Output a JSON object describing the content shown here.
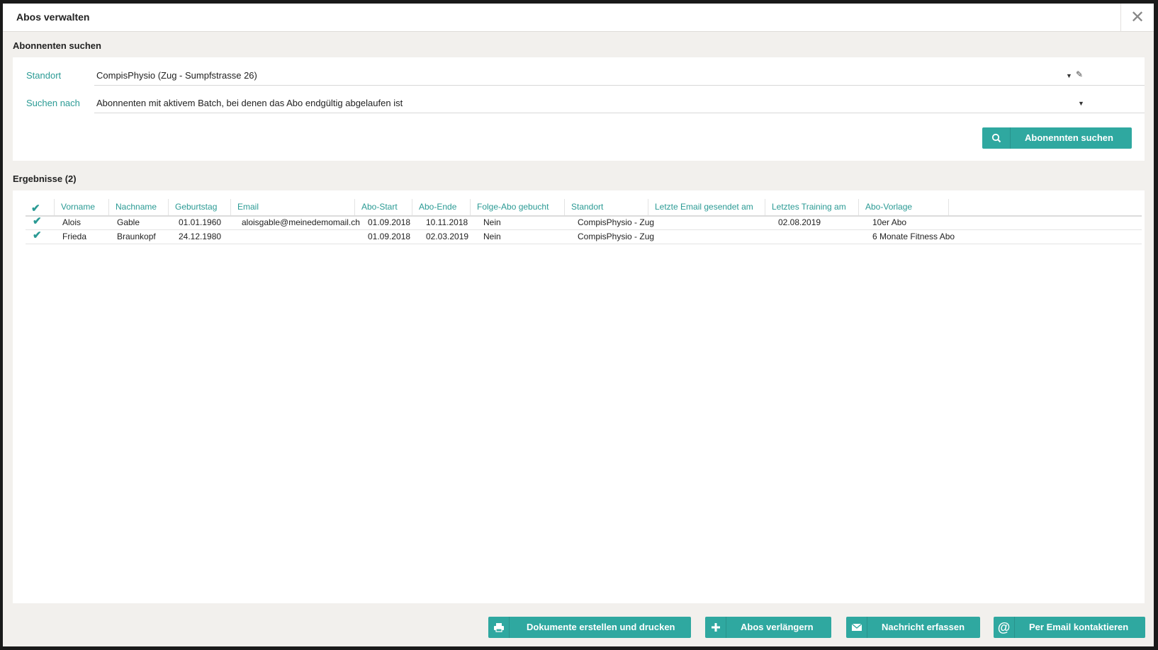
{
  "dialog": {
    "title": "Abos verwalten",
    "close_icon": "close-icon"
  },
  "search": {
    "section_title": "Abonnenten suchen",
    "standort_label": "Standort",
    "standort_value": "CompisPhysio (Zug - Sumpfstrasse 26)",
    "suchen_label": "Suchen nach",
    "suchen_value": "Abonnenten mit aktivem Batch, bei denen das Abo endgültig abgelaufen ist",
    "button_label": "Abonennten suchen"
  },
  "results": {
    "title": "Ergebnisse (2)",
    "columns": [
      "Vorname",
      "Nachname",
      "Geburtstag",
      "Email",
      "Abo-Start",
      "Abo-Ende",
      "Folge-Abo gebucht",
      "Standort",
      "Letzte Email gesendet am",
      "Letztes Training am",
      "Abo-Vorlage"
    ],
    "rows": [
      {
        "checked": true,
        "vorname": "Alois",
        "nachname": "Gable",
        "geburtstag": "01.01.1960",
        "email": "aloisgable@meinedemomail.ch",
        "abo_start": "01.09.2018",
        "abo_ende": "10.11.2018",
        "folge_abo": "Nein",
        "standort": "CompisPhysio - Zug",
        "letzte_email": "",
        "letztes_training": "02.08.2019",
        "abo_vorlage": "10er Abo"
      },
      {
        "checked": true,
        "vorname": "Frieda",
        "nachname": "Braunkopf",
        "geburtstag": "24.12.1980",
        "email": "",
        "abo_start": "01.09.2018",
        "abo_ende": "02.03.2019",
        "folge_abo": "Nein",
        "standort": "CompisPhysio - Zug",
        "letzte_email": "",
        "letztes_training": "",
        "abo_vorlage": "6 Monate Fitness Abo"
      }
    ]
  },
  "actions": {
    "print_label": "Dokumente erstellen und drucken",
    "extend_label": "Abos verlängern",
    "message_label": "Nachricht erfassen",
    "email_label": "Per Email kontaktieren"
  },
  "colors": {
    "accent": "#2fa8a0",
    "label_accent": "#2a9a94",
    "background": "#f2f0ed"
  }
}
